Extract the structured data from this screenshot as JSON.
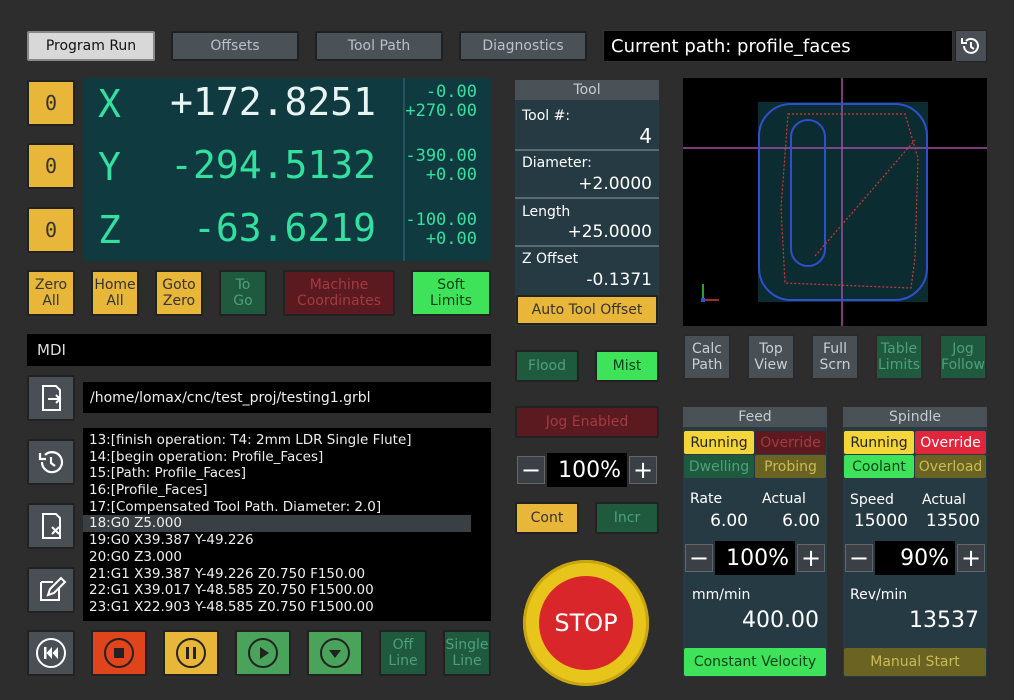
{
  "tabs": {
    "program_run": "Program Run",
    "offsets": "Offsets",
    "tool_path": "Tool Path",
    "diagnostics": "Diagnostics"
  },
  "current_path": "Current path: profile_faces",
  "axes": {
    "zero_label": "0",
    "x": {
      "letter": "X",
      "value": "+172.8251",
      "off1": "-0.00",
      "off2": "+270.00"
    },
    "y": {
      "letter": "Y",
      "value": "-294.5132",
      "off1": "-390.00",
      "off2": "+0.00"
    },
    "z": {
      "letter": "Z",
      "value": "-63.6219",
      "off1": "-100.00",
      "off2": "+0.00"
    }
  },
  "axis_buttons": {
    "zero_all": "Zero\nAll",
    "home_all": "Home\nAll",
    "goto_zero": "Goto\nZero",
    "to_go": "To\nGo",
    "machine_coords": "Machine\nCoordinates",
    "soft_limits": "Soft\nLimits"
  },
  "tool": {
    "title": "Tool",
    "num_label": "Tool #:",
    "num": "4",
    "diameter_label": "Diameter:",
    "diameter": "+2.0000",
    "length_label": "Length",
    "length": "+25.0000",
    "zoffset_label": "Z Offset",
    "zoffset": "-0.1371",
    "auto_offset": "Auto Tool Offset"
  },
  "flood": "Flood",
  "mist": "Mist",
  "jog_enabled": "Jog Enabled",
  "jog_pct": "100%",
  "cont": "Cont",
  "incr": "Incr",
  "stop": "STOP",
  "mdi_label": "MDI",
  "file_path": "/home/lomax/cnc/test_proj/testing1.grbl",
  "gcode": [
    "13:[finish operation: T4: 2mm LDR Single Flute]",
    "14:[begin operation: Profile_Faces]",
    "15:[Path: Profile_Faces]",
    "16:[Profile_Faces]",
    "17:[Compensated Tool Path. Diameter: 2.0]",
    "18:G0 Z5.000",
    "19:G0 X39.387 Y-49.226",
    "20:G0 Z3.000",
    "21:G1 X39.387 Y-49.226 Z0.750 F150.00",
    "22:G1 X39.017 Y-48.585 Z0.750 F1500.00",
    "23:G1 X22.903 Y-48.585 Z0.750 F1500.00"
  ],
  "gcode_selected_index": 5,
  "offline": "Off\nLine",
  "single_line": "Single\nLine",
  "view_buttons": {
    "calc_path": "Calc\nPath",
    "top_view": "Top\nView",
    "full_scrn": "Full\nScrn",
    "table_limits": "Table\nLimits",
    "jog_follow": "Jog\nFollow"
  },
  "feed": {
    "title": "Feed",
    "running": "Running",
    "override": "Override",
    "dwelling": "Dwelling",
    "probing": "Probing",
    "rate_label": "Rate",
    "actual_label": "Actual",
    "rate": "6.00",
    "actual": "6.00",
    "pct": "100%",
    "unit": "mm/min",
    "value": "400.00",
    "mode": "Constant Velocity"
  },
  "spindle": {
    "title": "Spindle",
    "running": "Running",
    "override": "Override",
    "coolant": "Coolant",
    "overload": "Overload",
    "speed_label": "Speed",
    "actual_label": "Actual",
    "speed": "15000",
    "actual": "13500",
    "pct": "90%",
    "unit": "Rev/min",
    "value": "13537",
    "mode": "Manual Start"
  },
  "colors": {
    "accent_green": "#3fe35a",
    "accent_yellow": "#e8b73a",
    "stop_red": "#d9262b",
    "dro_text": "#33e0a0"
  },
  "icons": [
    "history-icon",
    "load-file-icon",
    "recent-icon",
    "clear-file-icon",
    "edit-icon",
    "rewind-icon",
    "stop-icon",
    "pause-icon",
    "play-icon",
    "step-icon"
  ]
}
